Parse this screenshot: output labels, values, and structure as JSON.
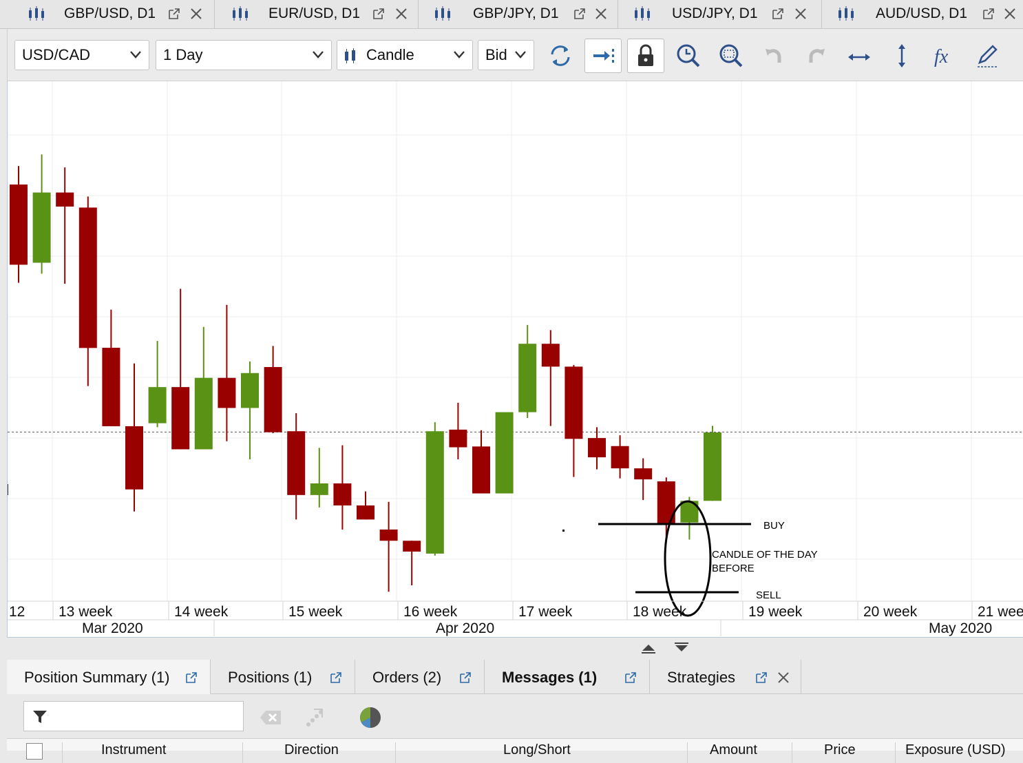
{
  "chart_tabs": [
    {
      "label": "GBP/USD, D1"
    },
    {
      "label": "EUR/USD, D1"
    },
    {
      "label": "GBP/JPY, D1"
    },
    {
      "label": "USD/JPY, D1"
    },
    {
      "label": "AUD/USD, D1"
    }
  ],
  "toolbar": {
    "instrument": "USD/CAD",
    "period": "1 Day",
    "chart_type": "Candle",
    "side": "Bid",
    "buttons": [
      "refresh-icon",
      "shift-chart-icon",
      "lock-icon",
      "zoom-time-icon",
      "zoom-area-icon",
      "undo-icon",
      "redo-icon",
      "horizontal-scale-icon",
      "vertical-scale-icon",
      "function-icon",
      "draw-icon"
    ]
  },
  "chart_data": {
    "type": "candlestick",
    "up_color": "#5a9216",
    "down_color": "#990000",
    "candles": [
      {
        "o": 1.436,
        "h": 1.4452,
        "l": 1.387,
        "c": 1.396
      },
      {
        "o": 1.397,
        "h": 1.451,
        "l": 1.3915,
        "c": 1.432
      },
      {
        "o": 1.432,
        "h": 1.4445,
        "l": 1.3865,
        "c": 1.425
      },
      {
        "o": 1.4245,
        "h": 1.43,
        "l": 1.3355,
        "c": 1.3545
      },
      {
        "o": 1.3546,
        "h": 1.3736,
        "l": 1.32,
        "c": 1.3155
      },
      {
        "o": 1.3155,
        "h": 1.3468,
        "l": 1.273,
        "c": 1.284
      },
      {
        "o": 1.317,
        "h": 1.358,
        "l": 1.315,
        "c": 1.335
      },
      {
        "o": 1.335,
        "h": 1.384,
        "l": 1.3145,
        "c": 1.304
      },
      {
        "o": 1.304,
        "h": 1.365,
        "l": 1.304,
        "c": 1.3396
      },
      {
        "o": 1.3396,
        "h": 1.376,
        "l": 1.308,
        "c": 1.3246
      },
      {
        "o": 1.3246,
        "h": 1.3478,
        "l": 1.299,
        "c": 1.342
      },
      {
        "o": 1.345,
        "h": 1.3555,
        "l": 1.312,
        "c": 1.3125
      },
      {
        "o": 1.313,
        "h": 1.322,
        "l": 1.269,
        "c": 1.2812
      },
      {
        "o": 1.2812,
        "h": 1.3047,
        "l": 1.275,
        "c": 1.287
      },
      {
        "o": 1.287,
        "h": 1.306,
        "l": 1.264,
        "c": 1.276
      },
      {
        "o": 1.276,
        "h": 1.283,
        "l": 1.269,
        "c": 1.269
      },
      {
        "o": 1.264,
        "h": 1.2778,
        "l": 1.233,
        "c": 1.2584
      },
      {
        "o": 1.2584,
        "h": 1.2504,
        "l": 1.2362,
        "c": 1.253
      },
      {
        "o": 1.252,
        "h": 1.3175,
        "l": 1.251,
        "c": 1.313
      },
      {
        "o": 1.3138,
        "h": 1.3272,
        "l": 1.299,
        "c": 1.305
      },
      {
        "o": 1.3054,
        "h": 1.3135,
        "l": 1.287,
        "c": 1.282
      },
      {
        "o": 1.282,
        "h": 1.322,
        "l": 1.294,
        "c": 1.3225
      },
      {
        "o": 1.3225,
        "h": 1.366,
        "l": 1.3196,
        "c": 1.3566
      },
      {
        "o": 1.3566,
        "h": 1.3634,
        "l": 1.3156,
        "c": 1.3452
      },
      {
        "o": 1.3452,
        "h": 1.346,
        "l": 1.2902,
        "c": 1.3092
      },
      {
        "o": 1.3096,
        "h": 1.315,
        "l": 1.294,
        "c": 1.3
      },
      {
        "o": 1.3056,
        "h": 1.311,
        "l": 1.2895,
        "c": 1.2945
      },
      {
        "o": 1.2945,
        "h": 1.2995,
        "l": 1.2787,
        "c": 1.289
      },
      {
        "o": 1.288,
        "h": 1.29,
        "l": 1.259,
        "c": 1.267
      },
      {
        "o": 1.2675,
        "h": 1.2803,
        "l": 1.259,
        "c": 1.2783
      },
      {
        "o": 1.2783,
        "h": 1.3157,
        "l": 1.2796,
        "c": 1.3124
      }
    ],
    "current_price": 1.3126,
    "x_axis": {
      "weeks": [
        "12",
        "13 week",
        "14 week",
        "15 week",
        "16 week",
        "17 week",
        "18 week",
        "19 week",
        "20 week",
        "21 wee"
      ],
      "months": [
        "Mar 2020",
        "Apr 2020",
        "May 2020"
      ]
    },
    "annotations": {
      "buy_label": "BUY",
      "sell_label": "SELL",
      "note_line1": "CANDLE OF THE DAY",
      "note_line2": "BEFORE"
    }
  },
  "panel": {
    "tabs": [
      {
        "label": "Position Summary (1)"
      },
      {
        "label": "Positions (1)"
      },
      {
        "label": "Orders (2)"
      },
      {
        "label": "Messages (1)"
      },
      {
        "label": "Strategies"
      }
    ],
    "filter_placeholder": "",
    "columns": [
      "Instrument",
      "Direction",
      "Long/Short",
      "Amount",
      "Price",
      "Exposure (USD)"
    ]
  }
}
